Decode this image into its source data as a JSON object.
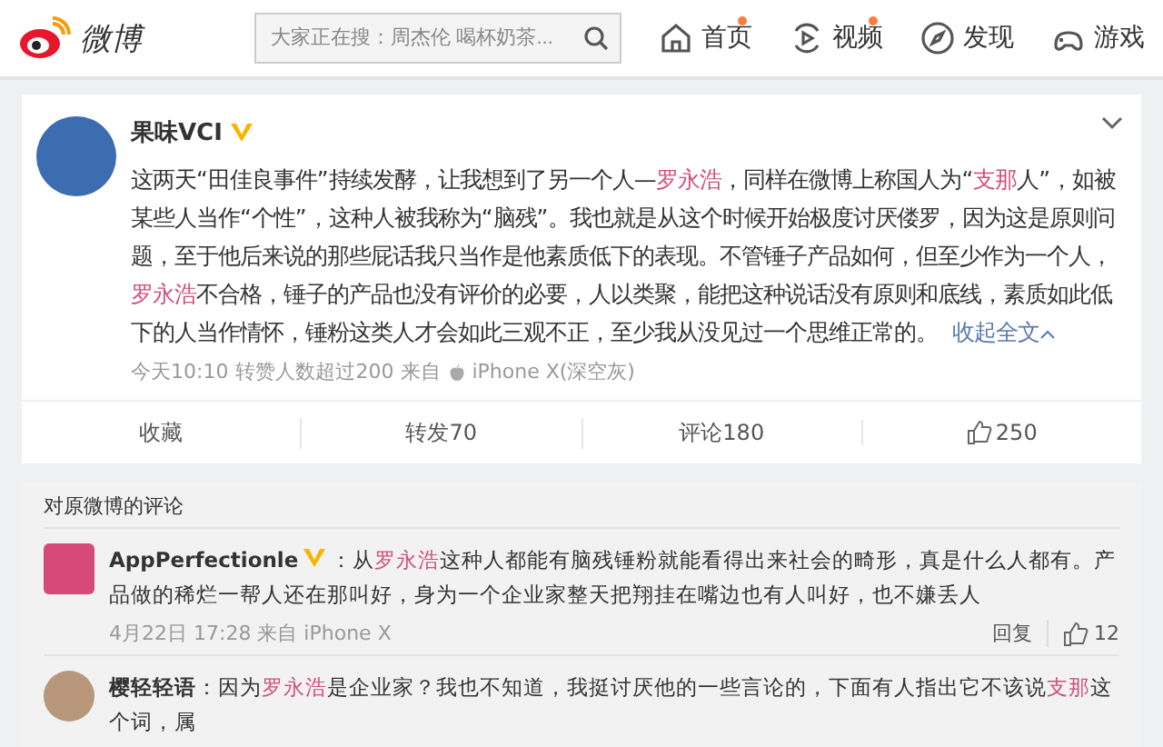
{
  "header": {
    "logo": "微博",
    "search": {
      "placeholder": "大家正在搜：周杰伦 喝杯奶茶..."
    },
    "nav": [
      {
        "label": "首页",
        "badge": true
      },
      {
        "label": "视频",
        "badge": true
      },
      {
        "label": "发现",
        "badge": false
      },
      {
        "label": "游戏",
        "badge": false
      }
    ]
  },
  "post": {
    "author": "果味VCI",
    "verified": true,
    "body": [
      {
        "kind": "text",
        "text": "这两天“田佳良事件”持续发酵，让我想到了另一个人—"
      },
      {
        "kind": "link",
        "text": "罗永浩"
      },
      {
        "kind": "text",
        "text": "，同样在微博上称国人为“"
      },
      {
        "kind": "link",
        "text": "支那"
      },
      {
        "kind": "text",
        "text": "人”，如被某些人当作“个性”，这种人被我称为“脑残”。我也就是从这个时候开始极度讨厌偻罗，因为这是原则问题，至于他后来说的那些屁话我只当作是他素质低下的表现。不管锤子产品如何，但至少作为一个人，"
      },
      {
        "kind": "link",
        "text": "罗永浩"
      },
      {
        "kind": "text",
        "text": "不合格，锤子的产品也没有评价的必要，人以类聚，能把这种说话没有原则和底线，素质如此低下的人当作情怀，锤粉这类人才会如此三观不正，至少我从没见过一个思维正常的。"
      }
    ],
    "collapse": "收起全文",
    "time": "今天10:10",
    "stat": "转赞人数超过200",
    "source": "来自",
    "device": "iPhone X(深空灰)",
    "actions": [
      {
        "kind": "text",
        "label": "收藏"
      },
      {
        "kind": "text",
        "label": "转发70"
      },
      {
        "kind": "text",
        "label": "评论180"
      },
      {
        "kind": "like",
        "label": "250"
      }
    ]
  },
  "comments": {
    "title": "对原微博的评论",
    "items": [
      {
        "author": "AppPerfectionle",
        "verified": true,
        "sep": "：",
        "body": [
          {
            "kind": "text",
            "text": "从"
          },
          {
            "kind": "link",
            "text": "罗永浩"
          },
          {
            "kind": "text",
            "text": "这种人都能有脑残锤粉就能看得出来社会的畸形，真是什么人都有。产品做的稀烂一帮人还在那叫好，身为一个企业家整天把翔挂在嘴边也有人叫好，也不嫌丢人"
          }
        ],
        "time": "4月22日 17:28 来自 iPhone X",
        "reply": "回复",
        "likes": "12"
      },
      {
        "author": "樱轻轻语",
        "sep": "：",
        "body": [
          {
            "kind": "text",
            "text": "因为"
          },
          {
            "kind": "link",
            "text": "罗永浩"
          },
          {
            "kind": "text",
            "text": "是企业家？我也不知道，我挺讨厌他的一些言论的，下面有人指出它不该说"
          },
          {
            "kind": "link",
            "text": "支那"
          },
          {
            "kind": "text",
            "text": "这个词，属"
          }
        ]
      }
    ]
  }
}
